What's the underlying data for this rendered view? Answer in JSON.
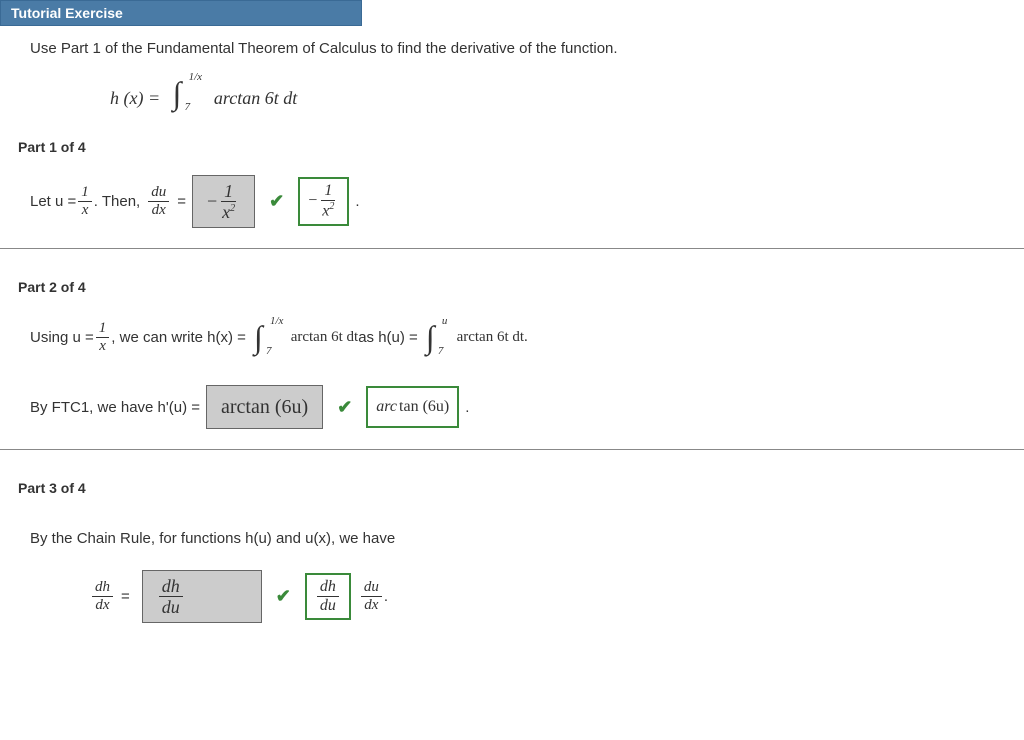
{
  "header": {
    "title": "Tutorial Exercise"
  },
  "prompt": "Use Part 1 of the Fundamental Theorem of Calculus to find the derivative of the function.",
  "given": {
    "lhs": "h (x) =",
    "int_lower": "7",
    "int_upper": "1/x",
    "integrand": "arctan 6t dt"
  },
  "parts": {
    "p1": {
      "title": "Part 1 of 4",
      "pre": "Let  u =",
      "u_num": "1",
      "u_den": "x",
      "mid": ".  Then,",
      "dudx_num": "du",
      "dudx_den": "dx",
      "eq": "=",
      "answer_neg": "−",
      "answer_num": "1",
      "answer_den_base": "x",
      "answer_den_exp": "2",
      "correct_neg": "−",
      "correct_num": "1",
      "correct_den_base": "x",
      "correct_den_exp": "2"
    },
    "p2": {
      "title": "Part 2 of 4",
      "line1_a": "Using  u =",
      "u_num": "1",
      "u_den": "x",
      "line1_b": ",  we can write  h(x) =",
      "int1_upper": "1/x",
      "int1_lower": "7",
      "integrand1": "arctan 6t dt",
      "as": "  as  h(u) =",
      "int2_upper": "u",
      "int2_lower": "7",
      "integrand2": "arctan 6t dt.",
      "line2_a": "By FTC1, we have  h'(u) =",
      "answer": "arctan (6u)",
      "correct_pre": "arc",
      "correct_mid": "tan",
      "correct_arg": "(6u)"
    },
    "p3": {
      "title": "Part 3 of 4",
      "line1": "By the Chain Rule, for functions  h(u)  and  u(x),  we have",
      "lhs_num": "dh",
      "lhs_den": "dx",
      "eq": "=",
      "ans_num": "dh",
      "ans_den": "du",
      "corr1_num": "dh",
      "corr1_den": "du",
      "corr2_num": "du",
      "corr2_den": "dx",
      "dot": "."
    }
  }
}
